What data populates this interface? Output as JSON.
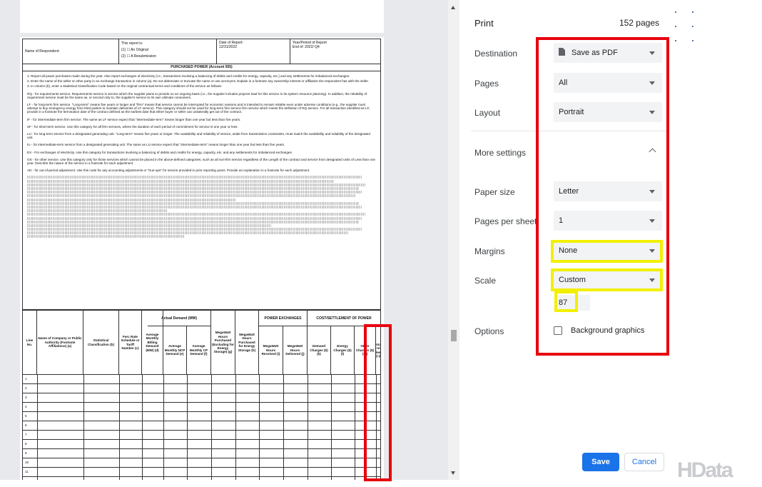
{
  "preview": {
    "form_header": {
      "respondent_label": "Name of Respondent:",
      "report_is_label": "This report is:",
      "original_option": "(1) ☐ An Original",
      "resubmission_option": "(2) ☐ A Resubmission",
      "date_label": "Date of Report:",
      "date_value": "12/31/2022",
      "period_label": "Year/Period of Report",
      "period_value": "End of: 2022/ Q4"
    },
    "section_title": "PURCHASED POWER (Account 555)",
    "instructions": [
      "1. Report all power purchases made during the year. Also report exchanges of electricity (i.e., transactions involving a balancing of debits and credits for energy, capacity, etc.) and any settlements for imbalanced exchanges.",
      "2. Enter the name of the seller or other party in an exchange transaction in column (a). Do not abbreviate or truncate the name or use acronyms. Explain in a footnote any ownership interest or affiliation the respondent has with the seller.",
      "3. In column (b), enter a Statistical Classification Code based on the original contractual terms and conditions of the service as follows:",
      "RQ - for requirements service. Requirements service is service which the supplier plans to provide on an ongoing basis (i.e., the supplier includes projects load for this service in its system resource planning). In addition, the reliability of requirement service must be the same as, or second only to, the supplier's service to its own ultimate consumers.",
      "LF - for long-term firm service. \"Long-term\" means five years or longer and \"firm\" means that service cannot be interrupted for economic reasons and is intended to remain reliable even under adverse conditions (e.g., the supplier must attempt to buy emergency energy from third parties to maintain deliveries of LF service). This category should not be used for long-term firm service firm service which meets the definition of RQ service. For all transaction identified as LF, provide in a footnote the termination date of the contract defined as the earliest date that either buyer or seller can unilaterally get out of the contract.",
      "IF - for intermediate-term firm service. The same as LF service expect that \"intermediate-term\" means longer than one year but less than five years.",
      "SF - for short-term service. Use this category for all firm services, where the duration of each period of commitment for service is one year or less.",
      "LU - for long-term service from a designated generating unit. \"Long-term\" means five years or longer. The availability and reliability of service, aside from transmission constraints, must match the availability and reliability of the designated unit.",
      "IU - for intermediate-term service from a designated generating unit. The same as LU service expect that \"intermediate-term\" means longer than one year but less than five years.",
      "EX - For exchanges of electricity. Use this category for transactions involving a balancing of debits and credits for energy, capacity, etc. and any settlements for imbalanced exchanges.",
      "OS - for other service. Use this category only for those services which cannot be placed in the above-defined categories, such as all non-firm service regardless of the Length of the contract and service from designated units of Less than one year. Describe the nature of the service in a footnote for each adjustment.",
      "AD - for out-of-period adjustment. Use this code for any accounting adjustments or \"true-ups\" for service provided in prior reporting years. Provide an explanation in a footnote for each adjustment."
    ],
    "grid": {
      "group_actual_demand": "Actual Demand (MW)",
      "group_power_exchanges": "POWER EXCHANGES",
      "group_cost_settlement": "COST/SETTLEMENT OF POWER",
      "columns": [
        "Line No.",
        "Name of Company or Public Authority (Footnote Affiliations) (a)",
        "Statistical Classification (b)",
        "Ferc Rate Schedule or Tariff Number (c)",
        "Average Monthly Billing Demand (MW) (d)",
        "Average Monthly NCP Demand (e)",
        "Average Monthly CP Demand (f)",
        "MegaWatt Hours Purchased (Excluding for Energy Storage) (g)",
        "MegaWatt Hours Purchased for Energy Storage (h)",
        "MegaWatt Hours Received (i)",
        "MegaWatt Hours Delivered (j)",
        "Demand Charges ($) (k)",
        "Energy Charges ($) (l)",
        "Other Charges ($) (m)",
        "Total (k+l+m) of Settlement ($) (n)"
      ],
      "rows": [
        "1",
        "2",
        "3",
        "4",
        "5",
        "6",
        "7",
        "8",
        "9",
        "10",
        "11"
      ]
    }
  },
  "panel": {
    "title": "Print",
    "page_count": "152 pages",
    "destination_label": "Destination",
    "destination_value": "Save as PDF",
    "pages_label": "Pages",
    "pages_value": "All",
    "layout_label": "Layout",
    "layout_value": "Portrait",
    "more_settings_label": "More settings",
    "paper_size_label": "Paper size",
    "paper_size_value": "Letter",
    "pages_per_sheet_label": "Pages per sheet",
    "pages_per_sheet_value": "1",
    "margins_label": "Margins",
    "margins_value": "None",
    "scale_label": "Scale",
    "scale_value": "Custom",
    "scale_input_value": "87",
    "options_label": "Options",
    "background_graphics_label": "Background graphics",
    "background_graphics_checked": false,
    "save_label": "Save",
    "cancel_label": "Cancel"
  },
  "watermark": "HData",
  "colors": {
    "annotation_red": "#e8000d",
    "annotation_yellow": "#f2f000",
    "accent_blue": "#1a73e8"
  }
}
